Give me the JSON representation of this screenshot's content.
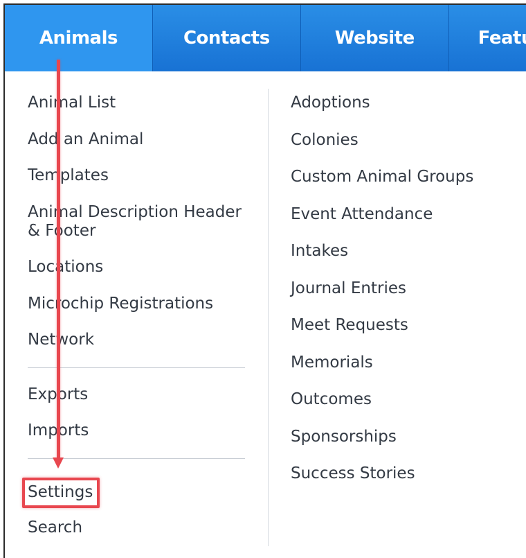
{
  "nav": {
    "tabs": [
      {
        "label": "Animals",
        "active": true
      },
      {
        "label": "Contacts",
        "active": false
      },
      {
        "label": "Website",
        "active": false
      },
      {
        "label": "Features",
        "active": false
      }
    ]
  },
  "menu": {
    "left": {
      "group1": [
        "Animal List",
        "Add an Animal",
        "Templates",
        "Animal Description Header & Footer",
        "Locations",
        "Microchip Registrations",
        "Network"
      ],
      "group2": [
        "Exports",
        "Imports"
      ],
      "settings": "Settings",
      "search": "Search"
    },
    "right": [
      "Adoptions",
      "Colonies",
      "Custom Animal Groups",
      "Event Attendance",
      "Intakes",
      "Journal Entries",
      "Meet Requests",
      "Memorials",
      "Outcomes",
      "Sponsorships",
      "Success Stories"
    ]
  },
  "colors": {
    "nav_blue": "#1872d4",
    "highlight_red": "#e8474f",
    "text": "#333a44"
  },
  "annotation": {
    "arrow_icon": "down-arrow-icon",
    "highlight": "settings-highlight-box"
  }
}
